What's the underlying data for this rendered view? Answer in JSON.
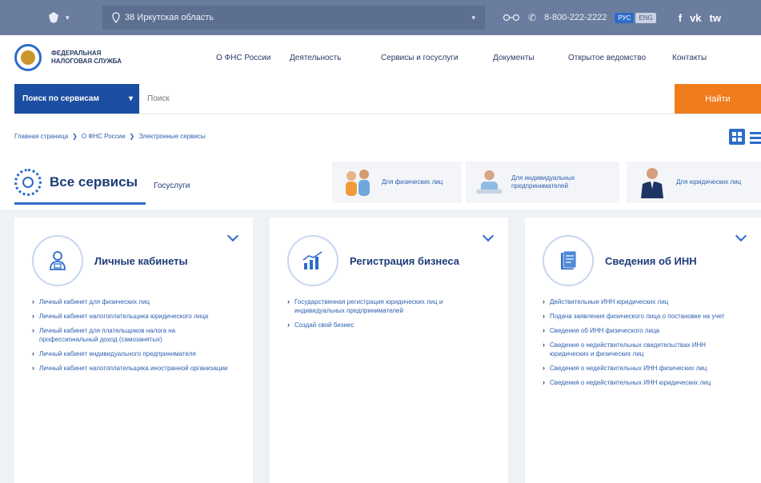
{
  "topbar": {
    "emblem_icon": "emblem-icon",
    "region_label": "38 Иркутская область",
    "phone": "8-800-222-2222",
    "lang_active": "РУС",
    "lang_inactive": "ENG",
    "social": [
      "f",
      "vk",
      "tw"
    ]
  },
  "header": {
    "logo_text": "ФЕДЕРАЛЬНАЯ НАЛОГОВАЯ СЛУЖБА",
    "nav": [
      "О ФНС России",
      "Деятельность",
      "Сервисы и госуслуги",
      "Документы",
      "Открытое ведомство",
      "Контакты"
    ]
  },
  "search": {
    "select_label": "Поиск по сервисам",
    "placeholder": "Поиск",
    "button": "Найти"
  },
  "breadcrumb": [
    "Главная страница",
    "О ФНС России",
    "Электронные сервисы"
  ],
  "tabs": {
    "all": "Все сервисы",
    "gosuslugi": "Госуслуги"
  },
  "audiences": [
    "Для физических лиц",
    "Для индивидуальных предпринимателей",
    "Для юридических лиц"
  ],
  "cards": [
    {
      "title": "Личные кабинеты",
      "links": [
        "Личный кабинет для физических лиц",
        "Личный кабинет налогоплательщика юридического лица",
        "Личный кабинет для плательщиков налога на профессиональный доход (самозанятых)",
        "Личный кабинет индивидуального предпринимателя",
        "Личный кабинет налогоплательщика иностранной организации"
      ]
    },
    {
      "title": "Регистрация бизнеса",
      "links": [
        "Государственная регистрация юридических лиц и индивидуальных предпринимателей",
        "Создай свой бизнес"
      ]
    },
    {
      "title": "Сведения об ИНН",
      "links": [
        "Действительные ИНН юридических лиц",
        "Подача заявления физического лица о постановке на учет",
        "Сведения об ИНН физического лица",
        "Сведения о недействительных свидетельствах ИНН юридических и физических лиц",
        "Сведения о недействительных ИНН физических лиц",
        "Сведения о недействительных ИНН юридических лиц"
      ]
    }
  ]
}
